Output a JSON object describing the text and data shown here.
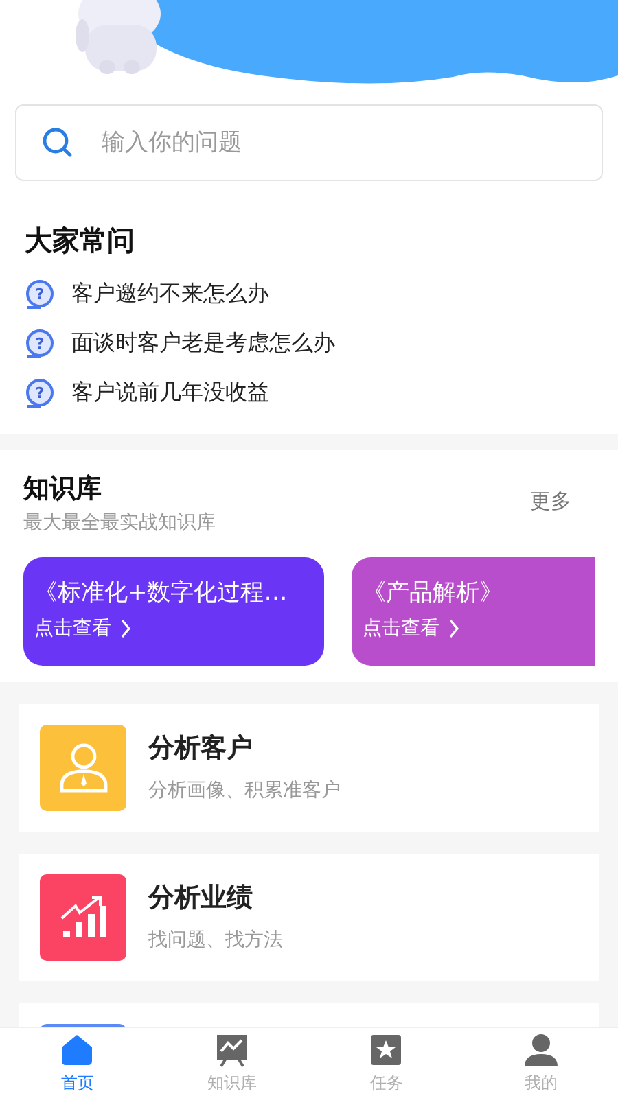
{
  "search": {
    "placeholder": "输入你的问题"
  },
  "faq": {
    "title": "大家常问",
    "items": [
      {
        "icon": "?",
        "text": "客户邀约不来怎么办"
      },
      {
        "icon": "?",
        "text": "面谈时客户老是考虑怎么办"
      },
      {
        "icon": "?",
        "text": "客户说前几年没收益"
      }
    ]
  },
  "knowledge": {
    "title": "知识库",
    "subtitle": "最大最全最实战知识库",
    "more": "更多",
    "cards": [
      {
        "title": "《标准化+数字化过程…",
        "link": "点击查看",
        "color": "#6a35f5"
      },
      {
        "title": "《产品解析》",
        "link": "点击查看",
        "color": "#b84ecb"
      }
    ]
  },
  "features": [
    {
      "kind": "customer",
      "title": "分析客户",
      "subtitle": "分析画像、积累准客户",
      "color": "#fdc03a"
    },
    {
      "kind": "performance",
      "title": "分析业绩",
      "subtitle": "找问题、找方法",
      "color": "#fb4463"
    },
    {
      "kind": "blank",
      "color": "#5b8af7"
    }
  ],
  "tabs": [
    {
      "kind": "home",
      "label": "首页",
      "selected": true
    },
    {
      "kind": "board",
      "label": "知识库",
      "selected": false
    },
    {
      "kind": "task",
      "label": "任务",
      "selected": false
    },
    {
      "kind": "profile",
      "label": "我的",
      "selected": false
    }
  ]
}
